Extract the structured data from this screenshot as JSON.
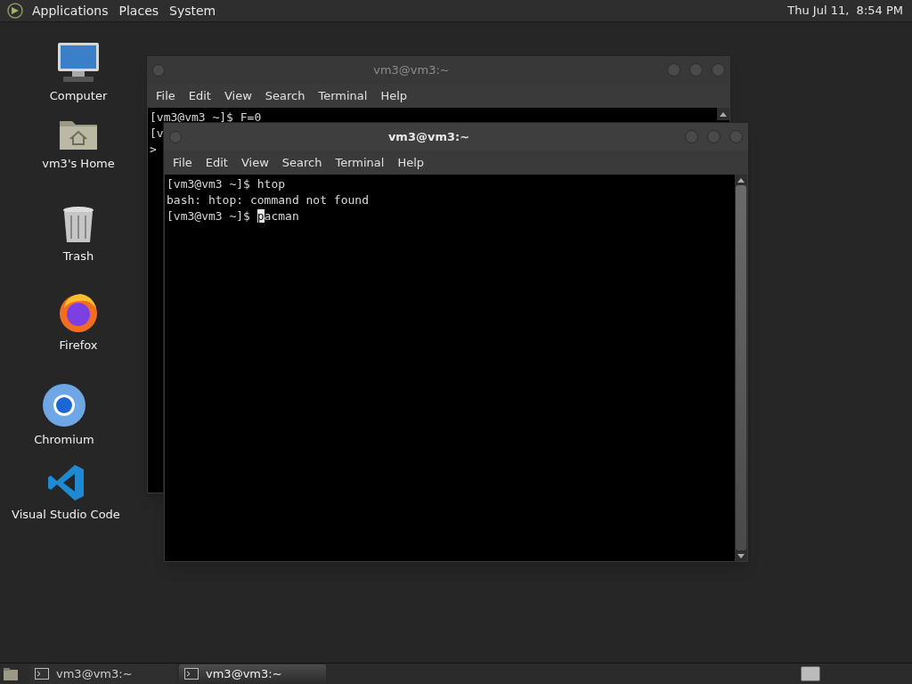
{
  "top_panel": {
    "menus": [
      "Applications",
      "Places",
      "System"
    ],
    "clock": "Thu Jul 11,  8:54 PM"
  },
  "desktop_icons": [
    {
      "kind": "computer",
      "label": "Computer"
    },
    {
      "kind": "home",
      "label": "vm3's Home"
    },
    {
      "kind": "trash",
      "label": "Trash"
    },
    {
      "kind": "firefox",
      "label": "Firefox"
    },
    {
      "kind": "chromium",
      "label": "Chromium"
    },
    {
      "kind": "vscode",
      "label": "Visual Studio Code"
    }
  ],
  "windows": [
    {
      "title": "vm3@vm3:~",
      "active": false,
      "menu": [
        "File",
        "Edit",
        "View",
        "Search",
        "Terminal",
        "Help"
      ],
      "lines": [
        {
          "text": "[vm3@vm3 ~]$ F=0"
        },
        {
          "text": "[v"
        },
        {
          "text": ">"
        }
      ]
    },
    {
      "title": "vm3@vm3:~",
      "active": true,
      "menu": [
        "File",
        "Edit",
        "View",
        "Search",
        "Terminal",
        "Help"
      ],
      "lines": [
        {
          "text": "[vm3@vm3 ~]$ htop"
        },
        {
          "text": "bash: htop: command not found"
        },
        {
          "text": "[vm3@vm3 ~]$ ",
          "cursor": "p",
          "after": "acman"
        }
      ]
    }
  ],
  "taskbar": {
    "tasks": [
      {
        "label": "vm3@vm3:~",
        "selected": false
      },
      {
        "label": "vm3@vm3:~",
        "selected": true
      }
    ]
  }
}
